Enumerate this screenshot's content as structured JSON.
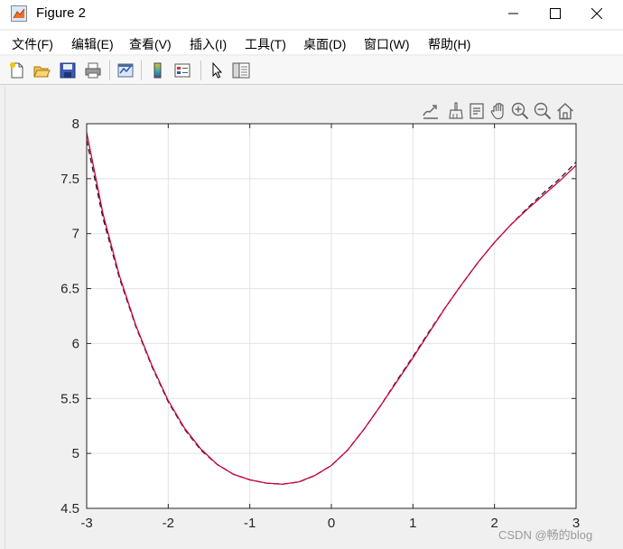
{
  "window": {
    "title": "Figure 2",
    "icons": [
      "matlab-figure-icon",
      "minimize-icon",
      "maximize-icon",
      "close-icon"
    ]
  },
  "menu": {
    "items": [
      {
        "label": "文件(F)"
      },
      {
        "label": "编辑(E)"
      },
      {
        "label": "查看(V)"
      },
      {
        "label": "插入(I)"
      },
      {
        "label": "工具(T)"
      },
      {
        "label": "桌面(D)"
      },
      {
        "label": "窗口(W)"
      },
      {
        "label": "帮助(H)"
      }
    ]
  },
  "toolbar": {
    "icons": [
      "new-figure-icon",
      "open-file-icon",
      "save-icon",
      "print-icon",
      "link-plot-icon",
      "colorbar-icon",
      "legend-icon",
      "edit-plot-icon",
      "property-inspector-icon"
    ]
  },
  "axes_toolbar": {
    "icons": [
      "export-icon",
      "brush-icon",
      "data-tips-icon",
      "pan-icon",
      "zoom-in-icon",
      "zoom-out-icon",
      "home-icon"
    ]
  },
  "colors": {
    "curve_primary": "#cc0044",
    "curve_secondary": "#1a1a1a",
    "grid": "#e3e3e3",
    "axes_bg": "#ffffff"
  },
  "chart_data": {
    "type": "line",
    "title": "",
    "xlabel": "",
    "ylabel": "",
    "xlim": [
      -3,
      3
    ],
    "ylim": [
      4.5,
      8
    ],
    "xticks": [
      "-3",
      "-2",
      "-1",
      "0",
      "1",
      "2",
      "3"
    ],
    "yticks": [
      "4.5",
      "5",
      "5.5",
      "6",
      "6.5",
      "7",
      "7.5",
      "8"
    ],
    "grid": true,
    "series": [
      {
        "style": "solid",
        "color": "#cc0044",
        "x": [
          -3.0,
          -2.8,
          -2.6,
          -2.4,
          -2.2,
          -2.0,
          -1.8,
          -1.6,
          -1.4,
          -1.2,
          -1.0,
          -0.8,
          -0.6,
          -0.4,
          -0.2,
          0.0,
          0.2,
          0.4,
          0.6,
          0.8,
          1.0,
          1.2,
          1.4,
          1.6,
          1.8,
          2.0,
          2.2,
          2.4,
          2.6,
          2.8,
          3.0
        ],
        "y": [
          7.92,
          7.18,
          6.62,
          6.17,
          5.8,
          5.48,
          5.23,
          5.04,
          4.9,
          4.81,
          4.76,
          4.73,
          4.72,
          4.74,
          4.8,
          4.89,
          5.03,
          5.22,
          5.43,
          5.65,
          5.87,
          6.1,
          6.33,
          6.54,
          6.74,
          6.92,
          7.08,
          7.22,
          7.35,
          7.48,
          7.62
        ]
      },
      {
        "style": "dashed",
        "color": "#1a1a1a",
        "x": [
          -3.0,
          -2.8,
          -2.6,
          -2.4,
          -2.2,
          -2.0,
          -1.8,
          -1.6,
          -1.4,
          -1.2,
          -1.0,
          -0.8,
          -0.6,
          -0.4,
          -0.2,
          0.0,
          0.2,
          0.4,
          0.6,
          0.8,
          1.0,
          1.2,
          1.4,
          1.6,
          1.8,
          2.0,
          2.2,
          2.4,
          2.6,
          2.8,
          3.0
        ],
        "y": [
          7.85,
          7.14,
          6.6,
          6.16,
          5.79,
          5.47,
          5.22,
          5.03,
          4.9,
          4.81,
          4.76,
          4.73,
          4.72,
          4.74,
          4.8,
          4.89,
          5.03,
          5.22,
          5.43,
          5.66,
          5.88,
          6.11,
          6.33,
          6.54,
          6.74,
          6.92,
          7.08,
          7.23,
          7.37,
          7.5,
          7.65
        ]
      }
    ]
  },
  "watermark": "CSDN @畅的blog"
}
